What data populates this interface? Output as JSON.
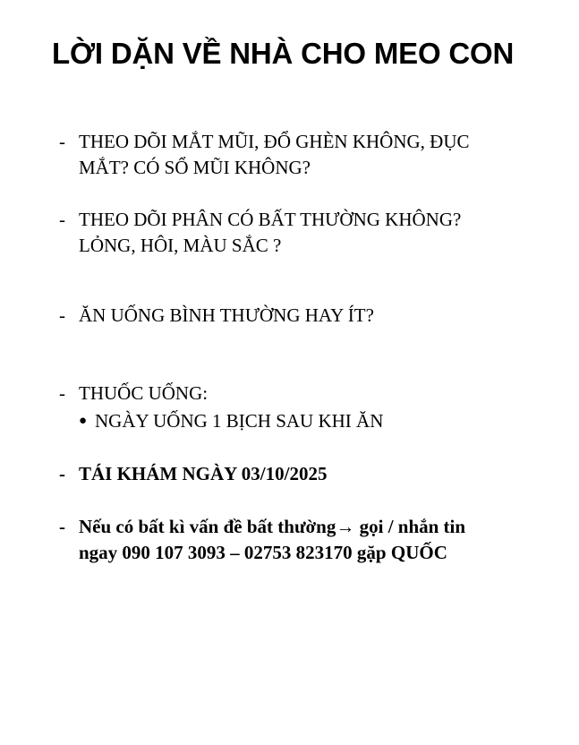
{
  "title": "LỜI DẶN VỀ NHÀ CHO MEO CON",
  "items": [
    {
      "marker": "-",
      "lines": [
        "THEO DÕI MẮT MŨI, ĐỔ GHÈN KHÔNG, ĐỤC",
        "MẮT? CÓ SỔ MŨI KHÔNG?"
      ]
    },
    {
      "marker": "-",
      "lines": [
        "THEO DÕI PHÂN CÓ BẤT THƯỜNG KHÔNG?",
        "LỎNG, HÔI, MÀU SẮC ?"
      ]
    },
    {
      "marker": "-",
      "lines": [
        "ĂN UỐNG BÌNH THƯỜNG HAY ÍT?"
      ]
    },
    {
      "marker": "-",
      "lines": [
        "THUỐC UỐNG:"
      ]
    },
    {
      "marker": "-",
      "lines": [
        "TÁI KHÁM NGÀY 03/10/2025"
      ]
    },
    {
      "marker": "-",
      "lines": [
        "Nếu có bất kì vấn đề bất thường→ gọi / nhắn tin",
        "ngay 090 107 3093 – 02753 823170 gặp QUỐC"
      ]
    }
  ],
  "subitems": [
    {
      "marker": "●",
      "text": "NGÀY UỐNG 1 BỊCH SAU KHI ĂN"
    }
  ]
}
